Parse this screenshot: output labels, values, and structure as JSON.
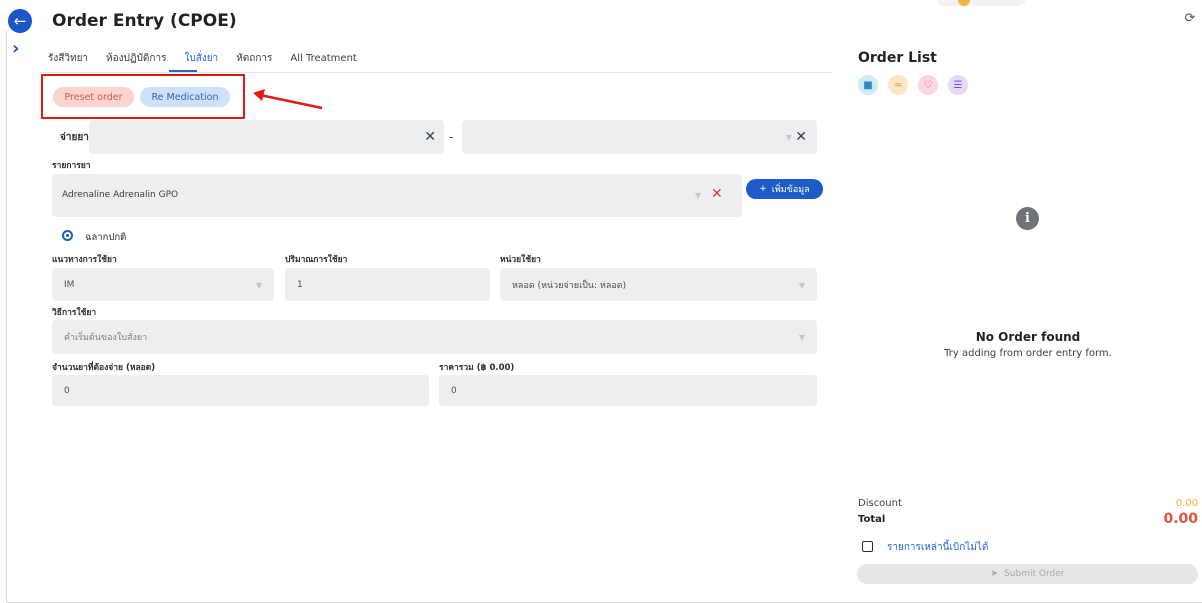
{
  "header": {
    "title": "Order Entry (CPOE)",
    "back_icon": "arrow-left-icon",
    "history_icon": "history-icon"
  },
  "tabs": [
    {
      "label": "รังสีวิทยา"
    },
    {
      "label": "ห้องปฏิบัติการ"
    },
    {
      "label": "ใบสั่งยา",
      "active": true
    },
    {
      "label": "หัตถการ"
    },
    {
      "label": "All Treatment"
    }
  ],
  "presets": {
    "preset_order": "Preset order",
    "re_medication": "Re Medication"
  },
  "form": {
    "dispense_label": "จ่ายยา:",
    "dispense_value": "",
    "dispense_value2": "",
    "dash": "-",
    "drug_list_label": "รายการยา",
    "drug_value": "Adrenaline Adrenalin GPO",
    "add_button": "เพิ่มข้อมูล",
    "radio_label": "ฉลากปกติ",
    "route_label": "แนวทางการใช้ยา",
    "route_value": "IM",
    "qty_label": "ปริมาณการใช้ยา",
    "qty_value": "1",
    "unit_label": "หน่วยใช้ยา",
    "unit_value": "หลอด (หน่วยจ่ายเป็น: หลอด)",
    "method_label": "วิธีการใช้ยา",
    "method_placeholder": "คำเริ่มต้นของใบสั่งยา",
    "dispense_qty_label": "จำนวนยาที่ต้องจ่าย (หลอด)",
    "dispense_qty_value": "0",
    "price_label": "ราคารวม (฿ 0.00)",
    "price_value": "0"
  },
  "order_list": {
    "title": "Order List",
    "icons": [
      "bed-icon",
      "route-icon",
      "heart-icon",
      "list-icon"
    ],
    "empty_title": "No Order found",
    "empty_sub": "Try adding from order entry form.",
    "discount_label": "Discount",
    "discount_value": "0.00",
    "total_label": "Total",
    "total_value": "0.00",
    "checkbox_label": "รายการเหล่านี้เบิกไม่ได้",
    "submit_label": "Submit Order"
  },
  "colors": {
    "primary": "#1f5bc6",
    "preset_bg": "#fbd3cf",
    "remed_bg": "#cfe0f9",
    "highlight_box": "#e01919",
    "total": "#e0533f",
    "discount": "#e2b13c"
  }
}
